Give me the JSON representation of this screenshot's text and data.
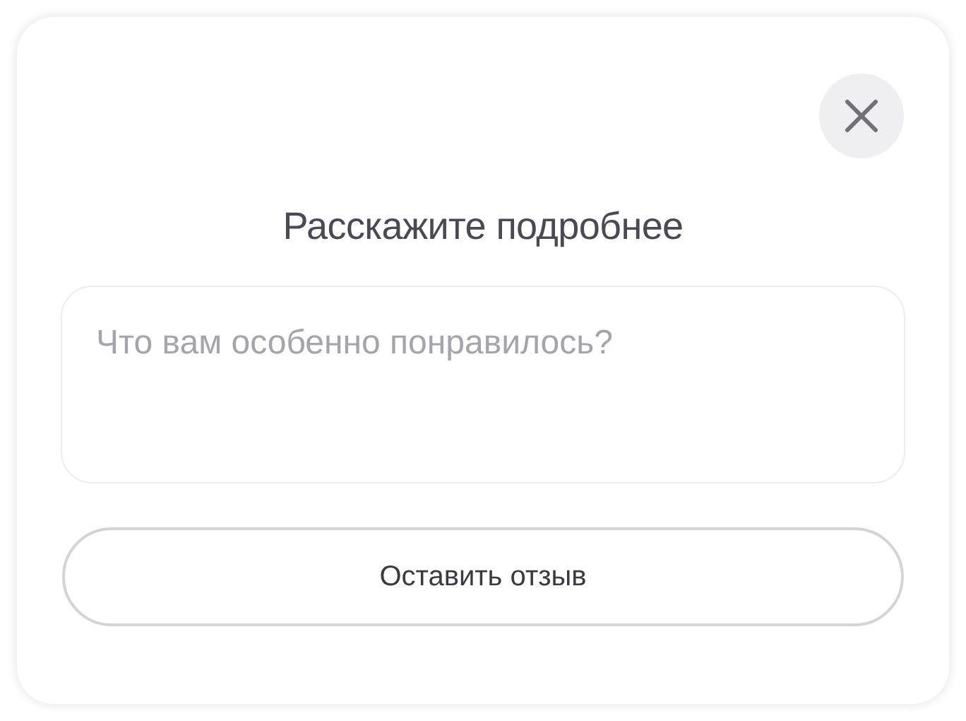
{
  "dialog": {
    "title": "Расскажите подробнее",
    "feedback_field": {
      "placeholder": "Что вам особенно понравилось?"
    },
    "buttons": [
      {
        "label": "Оставить отзыв"
      }
    ]
  }
}
